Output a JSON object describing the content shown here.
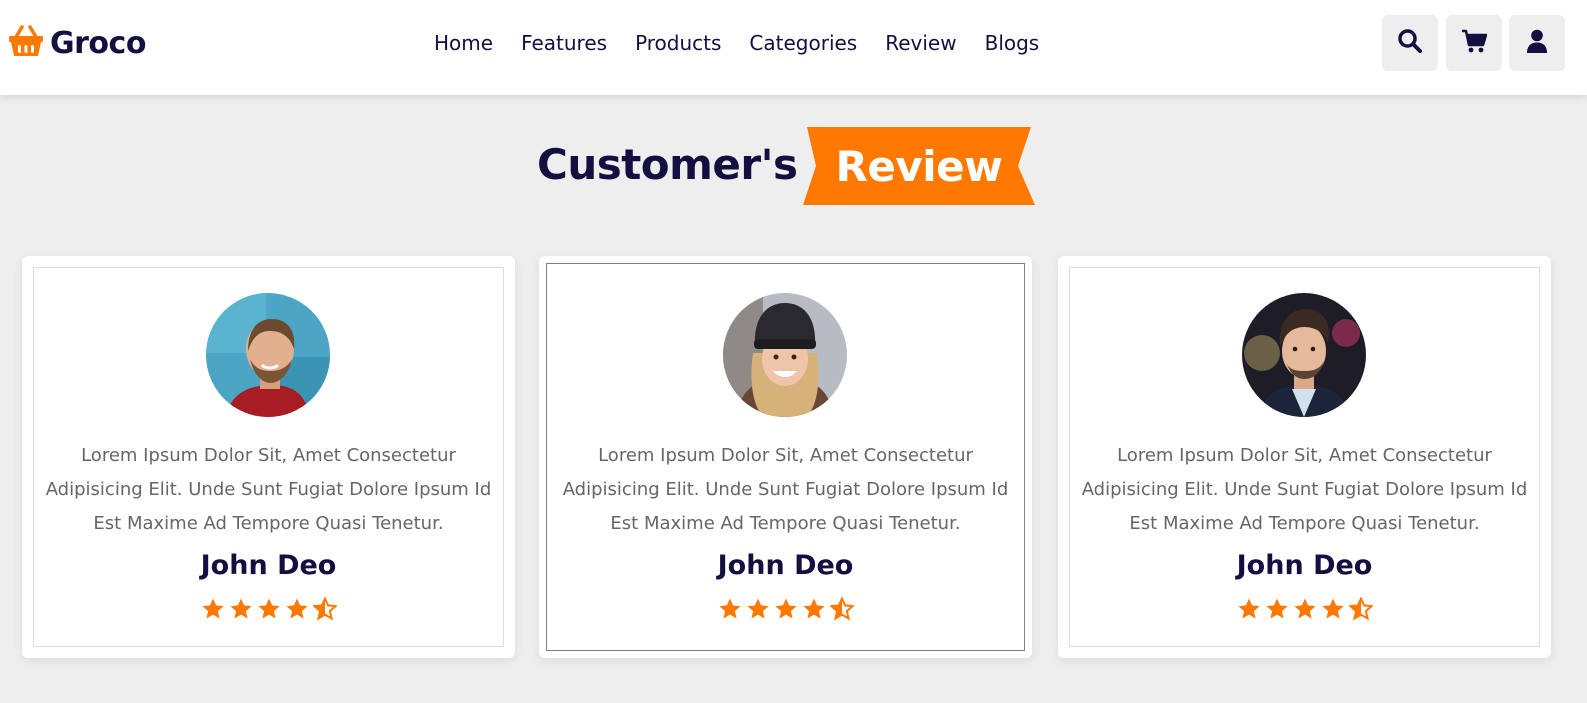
{
  "header": {
    "logo_icon": "shopping-basket-icon",
    "logo_text": "Groco",
    "nav": [
      "Home",
      "Features",
      "Products",
      "Categories",
      "Review",
      "Blogs"
    ],
    "icons": [
      "search-icon",
      "cart-icon",
      "user-icon"
    ]
  },
  "review_section": {
    "heading_main": "Customer's",
    "heading_highlight": "Review",
    "cards": [
      {
        "text": "Lorem Ipsum Dolor Sit, Amet Consectetur Adipisicing Elit. Unde Sunt Fugiat Dolore Ipsum Id Est Maxime Ad Tempore Quasi Tenetur.",
        "name": "John Deo",
        "rating": 4.5
      },
      {
        "text": "Lorem Ipsum Dolor Sit, Amet Consectetur Adipisicing Elit. Unde Sunt Fugiat Dolore Ipsum Id Est Maxime Ad Tempore Quasi Tenetur.",
        "name": "John Deo",
        "rating": 4.5
      },
      {
        "text": "Lorem Ipsum Dolor Sit, Amet Consectetur Adipisicing Elit. Unde Sunt Fugiat Dolore Ipsum Id Est Maxime Ad Tempore Quasi Tenetur.",
        "name": "John Deo",
        "rating": 4.5
      }
    ]
  },
  "colors": {
    "accent": "#ff7800",
    "dark": "#130f40",
    "background": "#eeeeee",
    "text_muted": "#666666"
  }
}
